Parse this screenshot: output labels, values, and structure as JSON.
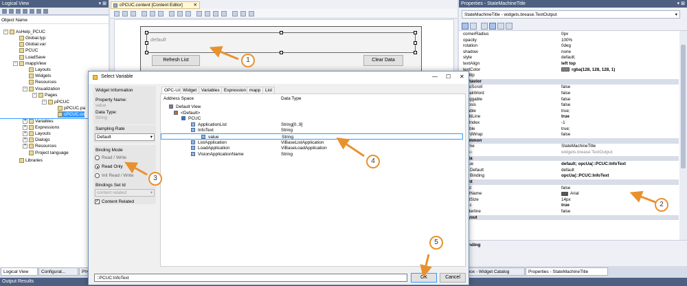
{
  "logical_view": {
    "title": "Logical View",
    "pin": "▾ ⊠",
    "column": "Object Name",
    "items": [
      {
        "label": "AsHelp_PCUC",
        "expanded": true
      },
      {
        "label": "Global.typ"
      },
      {
        "label": "Global.var"
      },
      {
        "label": "PCUC"
      },
      {
        "label": "LoadSave"
      },
      {
        "label": "mappView",
        "expanded": true
      },
      {
        "label": "Layouts"
      },
      {
        "label": "Widgets"
      },
      {
        "label": "Resources"
      },
      {
        "label": "Visualization",
        "expanded": true
      },
      {
        "label": "Pages",
        "expanded": true
      },
      {
        "label": "pPCUC",
        "expanded": true
      },
      {
        "label": "pPCUC.pa"
      },
      {
        "label": "cPCUC.co"
      },
      {
        "label": "Variables"
      },
      {
        "label": "Expressions"
      },
      {
        "label": "Layouts"
      },
      {
        "label": "Dialogs"
      },
      {
        "label": "Resources"
      },
      {
        "label": "Project language"
      },
      {
        "label": "Libraries"
      }
    ],
    "tabs": [
      "Logical View",
      "Configurat...",
      "Phys"
    ]
  },
  "editor": {
    "tab_title": "cPCUC.content [Content Editor]",
    "default_text": "default",
    "refresh_label": "Refresh List",
    "clear_label": "Clear Data"
  },
  "dialog": {
    "title": "Select Variable",
    "widget_info_label": "Widget Information",
    "property_name_label": "Property Name:",
    "property_name_value": "value",
    "data_type_label": "Data Type:",
    "data_type_value": "String",
    "sampling_rate_label": "Sampling Rate",
    "sampling_rate_value": "Default",
    "binding_mode_label": "Binding Mode",
    "modes": [
      "Read / Write",
      "Read Only",
      "Init Read / Write"
    ],
    "bindings_set_label": "Bindings Set Id",
    "bindings_set_value": "content related",
    "content_related_label": "Content Related",
    "tabs": [
      "OPC-UA",
      "Widget",
      "Variables",
      "Expression",
      "mapp",
      "List"
    ],
    "col_address": "Address Space",
    "col_type": "Data Type",
    "rows": [
      {
        "name": "Default View",
        "type": ""
      },
      {
        "name": "<Default>",
        "type": ""
      },
      {
        "name": "PCUC",
        "type": ""
      },
      {
        "name": "ApplicationList",
        "type": "String[0..9]"
      },
      {
        "name": "InfoText",
        "type": "String"
      },
      {
        "name": "value",
        "type": "String"
      },
      {
        "name": "ListApplication",
        "type": "ViBaseListApplication"
      },
      {
        "name": "LoadApplication",
        "type": "ViBaseLoadApplication"
      },
      {
        "name": "VisionApplicationName",
        "type": "String"
      }
    ],
    "path_value": "::PCUC:InfoText",
    "ok_label": "OK",
    "cancel_label": "Cancel",
    "minimize": "—",
    "maximize": "☐",
    "close": "✕"
  },
  "properties": {
    "title": "Properties - StateMachineTitle",
    "selector": "StateMachineTitle - widgets.brease.TextOutput",
    "rows": [
      {
        "n": "cornerRadius",
        "v": "0px"
      },
      {
        "n": "opacity",
        "v": "100%"
      },
      {
        "n": "rotation",
        "v": "0deg"
      },
      {
        "n": "shadow",
        "v": "none"
      },
      {
        "n": "style",
        "v": "default;"
      },
      {
        "n": "textAlign",
        "v": "left top",
        "bold": true
      },
      {
        "n": "textColor",
        "v": "rgba(128, 128, 128, 1)",
        "bold": true,
        "swatch": true
      },
      {
        "n": "tooltip",
        "v": ""
      },
      {
        "n": "Behavior",
        "cat": true
      },
      {
        "n": "autoScroll",
        "v": "false"
      },
      {
        "n": "breakWord",
        "v": "false"
      },
      {
        "n": "draggable",
        "v": "false"
      },
      {
        "n": "ellipsis",
        "v": "false"
      },
      {
        "n": "enable",
        "v": "true;"
      },
      {
        "n": "multiLine",
        "v": "true",
        "bold": true
      },
      {
        "n": "tabIndex",
        "v": "-1"
      },
      {
        "n": "visible",
        "v": "true;"
      },
      {
        "n": "wordWrap",
        "v": "false"
      },
      {
        "n": "Common",
        "cat": true
      },
      {
        "n": "Name",
        "v": "StateMachineTitle"
      },
      {
        "n": "Type",
        "v": "widgets.brease.TextOutput",
        "grey": true
      },
      {
        "n": "Data",
        "cat": true
      },
      {
        "n": "value",
        "v": "default; opcUa(::PCUC:InfoText",
        "bold": true
      },
      {
        "n": "Default",
        "v": "default",
        "sub": true
      },
      {
        "n": "Binding",
        "v": "opcUa(::PCUC:InfoText",
        "bold": true,
        "sub": true
      },
      {
        "n": "Font",
        "cat": true
      },
      {
        "n": "bold",
        "v": "false"
      },
      {
        "n": "fontName",
        "v": "Arial",
        "font": true
      },
      {
        "n": "fontSize",
        "v": "14px"
      },
      {
        "n": "italic",
        "v": "true",
        "bold": true
      },
      {
        "n": "underline",
        "v": "false"
      },
      {
        "n": "Layout",
        "cat": true
      }
    ],
    "binding_label": "inding",
    "tabs": [
      "oolbox - Widget Catalog",
      "Properties - StateMachineTitle"
    ]
  },
  "output": {
    "title": "Output Results"
  },
  "callouts": [
    "1",
    "2",
    "3",
    "4",
    "5"
  ],
  "colors": {
    "accent": "#e8912e",
    "header": "#4d6082",
    "selection": "#3399ff"
  }
}
